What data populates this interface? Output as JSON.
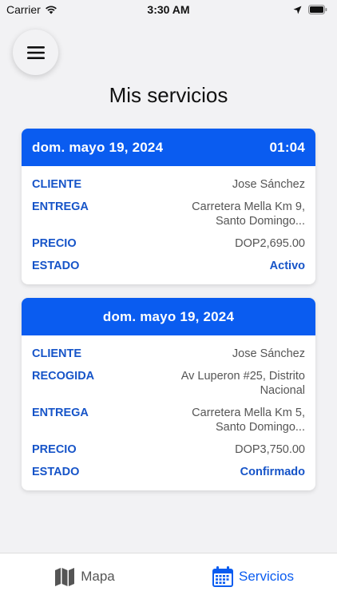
{
  "status_bar": {
    "carrier": "Carrier",
    "time": "3:30 AM"
  },
  "page": {
    "title": "Mis servicios"
  },
  "services": [
    {
      "date": "dom. mayo 19, 2024",
      "time": "01:04",
      "rows": [
        {
          "label": "CLIENTE",
          "value": "Jose Sánchez"
        },
        {
          "label": "ENTREGA",
          "value": "Carretera Mella Km 9, Santo Domingo..."
        },
        {
          "label": "PRECIO",
          "value": "DOP2,695.00"
        },
        {
          "label": "ESTADO",
          "value": "Activo"
        }
      ]
    },
    {
      "date": "dom. mayo 19, 2024",
      "rows": [
        {
          "label": "CLIENTE",
          "value": "Jose Sánchez"
        },
        {
          "label": "RECOGIDA",
          "value": "Av Luperon #25, Distrito Nacional"
        },
        {
          "label": "ENTREGA",
          "value": "Carretera Mella Km 5, Santo Domingo..."
        },
        {
          "label": "PRECIO",
          "value": "DOP3,750.00"
        },
        {
          "label": "ESTADO",
          "value": "Confirmado"
        }
      ]
    }
  ],
  "tabs": [
    {
      "label": "Mapa",
      "icon": "map-icon",
      "active": false
    },
    {
      "label": "Servicios",
      "icon": "calendar-icon",
      "active": true
    }
  ],
  "colors": {
    "accent": "#0a5cf0",
    "label": "#1654c8",
    "background": "#f2f2f4"
  }
}
